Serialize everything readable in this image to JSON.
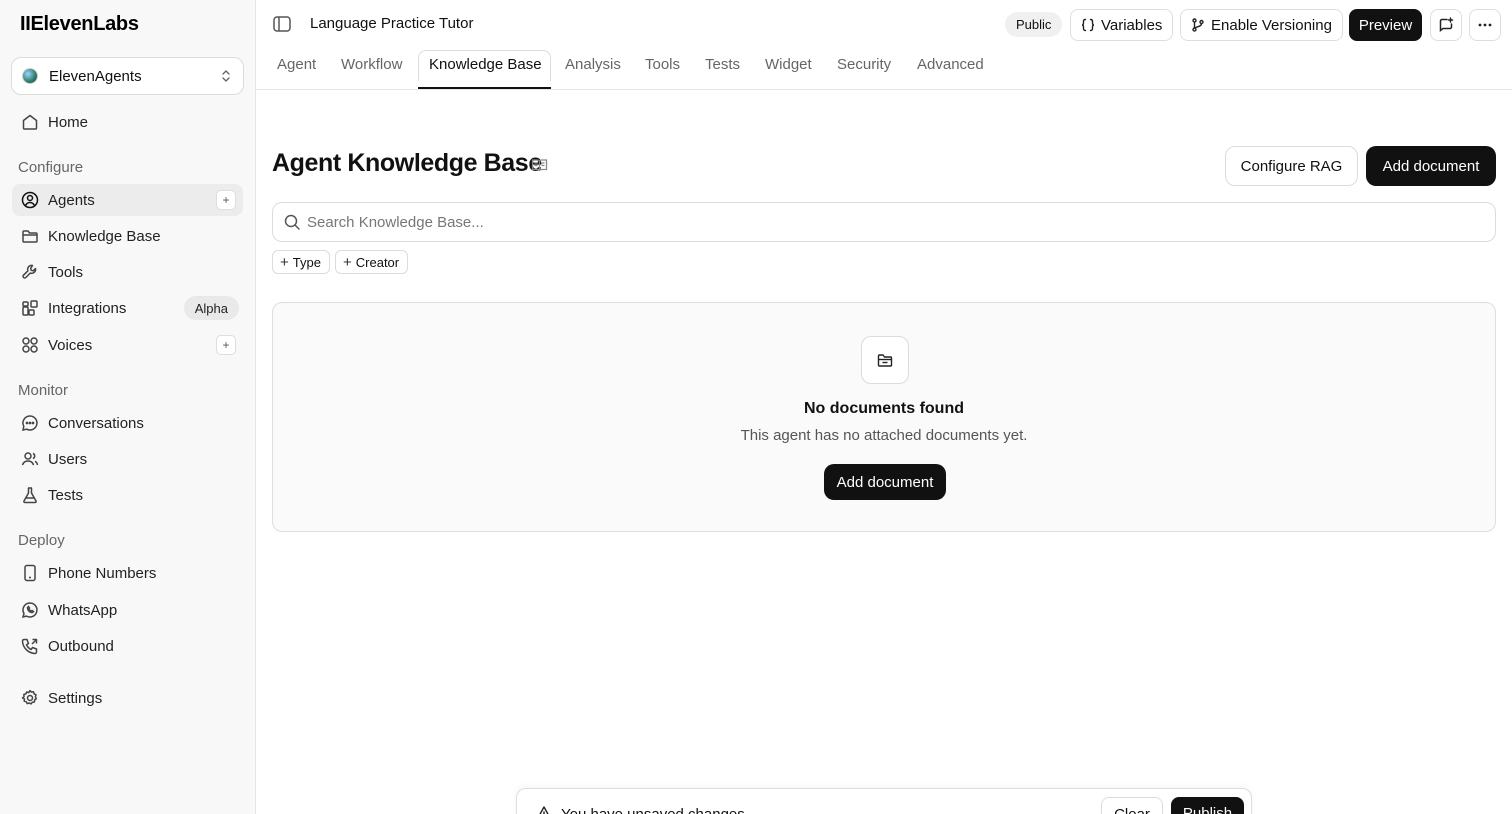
{
  "sidebar": {
    "logo": "IIElevenLabs",
    "workspace": "ElevenAgents",
    "home": "Home",
    "sections": {
      "configure": "Configure",
      "monitor": "Monitor",
      "deploy": "Deploy"
    },
    "configure_items": {
      "agents": "Agents",
      "knowledge_base": "Knowledge Base",
      "tools": "Tools",
      "integrations": "Integrations",
      "integrations_badge": "Alpha",
      "voices": "Voices"
    },
    "monitor_items": {
      "conversations": "Conversations",
      "users": "Users",
      "tests": "Tests"
    },
    "deploy_items": {
      "phone_numbers": "Phone Numbers",
      "whatsapp": "WhatsApp",
      "outbound": "Outbound"
    },
    "settings": "Settings",
    "plus": "+"
  },
  "header": {
    "title": "Language Practice Tutor",
    "visibility": "Public",
    "variables": "Variables",
    "enable_versioning": "Enable Versioning",
    "preview": "Preview"
  },
  "tabs": {
    "agent": "Agent",
    "workflow": "Workflow",
    "knowledge_base": "Knowledge Base",
    "analysis": "Analysis",
    "tools": "Tools",
    "tests": "Tests",
    "widget": "Widget",
    "security": "Security",
    "advanced": "Advanced"
  },
  "main": {
    "title": "Agent Knowledge Base",
    "configure_rag": "Configure RAG",
    "add_document": "Add document",
    "search_placeholder": "Search Knowledge Base...",
    "filters": {
      "type": "Type",
      "creator": "Creator"
    },
    "empty": {
      "title": "No documents found",
      "subtitle": "This agent has no attached documents yet.",
      "button": "Add document"
    }
  },
  "unsaved_bar": {
    "message": "You have unsaved changes",
    "clear": "Clear",
    "publish": "Publish"
  }
}
